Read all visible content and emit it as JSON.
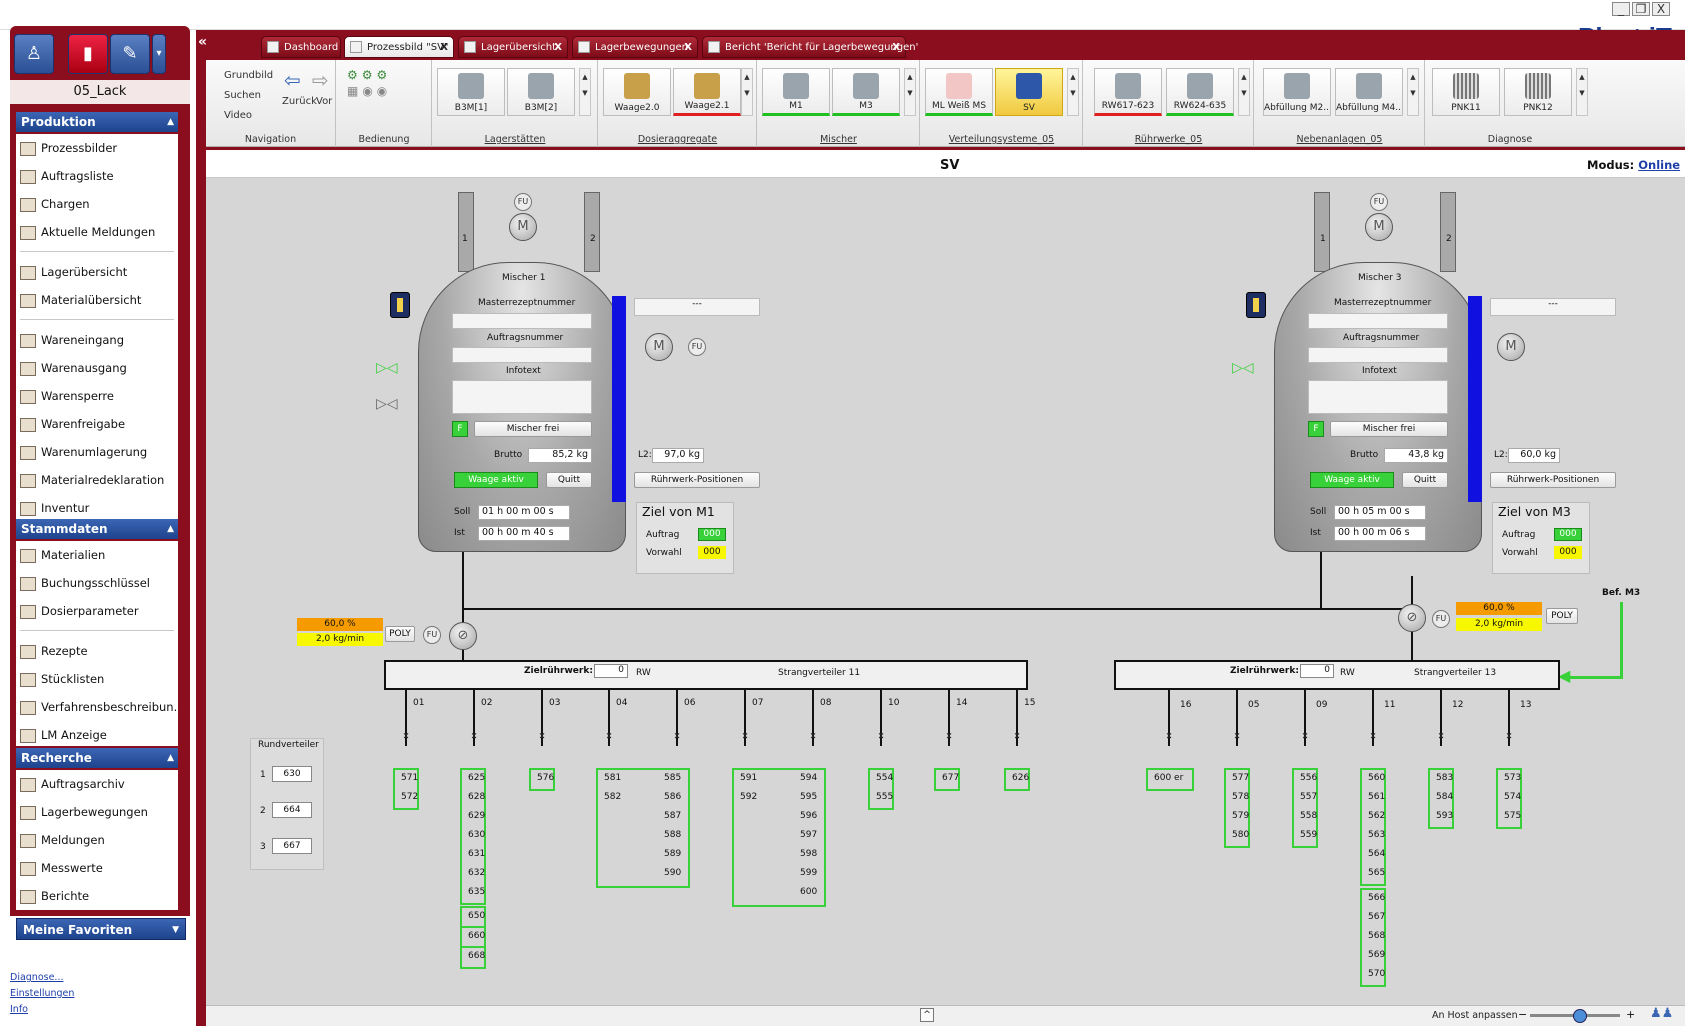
{
  "window": {
    "brand": "Plant iT",
    "controls": [
      "_",
      "❐",
      "X"
    ]
  },
  "sidebar": {
    "mode": "05_Lack",
    "sections": [
      {
        "title": "Produktion",
        "items": [
          "Prozessbilder",
          "Auftragsliste",
          "Chargen",
          "Aktuelle Meldungen",
          "Lagerübersicht",
          "Materialübersicht",
          "Wareneingang",
          "Warenausgang",
          "Warensperre",
          "Warenfreigabe",
          "Warenumlagerung",
          "Materialredeklaration",
          "Inventur"
        ]
      },
      {
        "title": "Stammdaten",
        "items": [
          "Materialien",
          "Buchungsschlüssel",
          "Dosierparameter",
          "Rezepte",
          "Stücklisten",
          "Verfahrensbeschreibun...",
          "LM Anzeige"
        ]
      },
      {
        "title": "Recherche",
        "items": [
          "Auftragsarchiv",
          "Lagerbewegungen",
          "Meldungen",
          "Messwerte",
          "Berichte"
        ]
      }
    ],
    "favorites": "Meine Favoriten",
    "footer_links": [
      "Diagnose...",
      "Einstellungen",
      "Info"
    ]
  },
  "tabs": [
    "Dashboard",
    "Prozessbild \"SV\"",
    "Lagerübersicht",
    "Lagerbewegungen",
    "Bericht 'Bericht für Lagerbewegungen'"
  ],
  "ribbon": {
    "nav": {
      "grundbild": "Grundbild",
      "suchen": "Suchen",
      "video": "Video",
      "zurueck": "Zurück",
      "vor": "Vor",
      "title": "Navigation"
    },
    "bedienung": "Bedienung",
    "groups": [
      {
        "title": "Lagerstätten",
        "buttons": [
          "B3M[1]",
          "B3M[2]"
        ]
      },
      {
        "title": "Dosieraggregate",
        "buttons": [
          "Waage2.0",
          "Waage2.1"
        ]
      },
      {
        "title": "Mischer",
        "buttons": [
          "M1",
          "M3"
        ]
      },
      {
        "title": "Verteilungsysteme_05",
        "buttons": [
          "ML Weiß MS",
          "SV"
        ]
      },
      {
        "title": "Rührwerke_05",
        "buttons": [
          "RW617-623",
          "RW624-635"
        ]
      },
      {
        "title": "Nebenanlagen_05",
        "buttons": [
          "Abfüllung M2...",
          "Abfüllung M4..."
        ]
      },
      {
        "title": "Diagnose",
        "buttons": [
          "PNK11",
          "PNK12"
        ]
      }
    ]
  },
  "page": {
    "title": "SV",
    "modus_label": "Modus:",
    "modus_value": "Online"
  },
  "status": {
    "host": "An Host anpassen",
    "zoom_minus": "−",
    "zoom_plus": "+"
  },
  "mixer1": {
    "name": "Mischer 1",
    "fu": "FU",
    "nozzle_left": "1",
    "nozzle_right": "2",
    "rezept": "Masterrezeptnummer",
    "auftrag": "Auftragsnummer",
    "info": "Infotext",
    "f": "F",
    "frei": "Mischer frei",
    "brutto_lbl": "Brutto",
    "brutto": "85,2 kg",
    "waage": "Waage aktiv",
    "quitt": "Quitt",
    "l2_lbl": "L2:",
    "l2": "97,0 kg",
    "ruehr": "Rührwerk-Positionen",
    "dash": "---",
    "soll_lbl": "Soll",
    "soll": "01 h 00 m 00 s",
    "ist_lbl": "Ist",
    "ist": "00 h 00 m 40 s",
    "ziel": "Ziel von M1",
    "auftrag_lbl": "Auftrag",
    "auftrag_val": "000",
    "vorwahl_lbl": "Vorwahl",
    "vorwahl_val": "000",
    "pct": "60,0 %",
    "rate": "2,0 kg/min",
    "poly": "POLY"
  },
  "mixer3": {
    "name": "Mischer 3",
    "fu": "FU",
    "nozzle_left": "1",
    "nozzle_right": "2",
    "rezept": "Masterrezeptnummer",
    "auftrag": "Auftragsnummer",
    "info": "Infotext",
    "f": "F",
    "frei": "Mischer frei",
    "brutto_lbl": "Brutto",
    "brutto": "43,8 kg",
    "waage": "Waage aktiv",
    "quitt": "Quitt",
    "l2_lbl": "L2:",
    "l2": "60,0 kg",
    "ruehr": "Rührwerk-Positionen",
    "dash": "---",
    "soll_lbl": "Soll",
    "soll": "00 h 05 m 00 s",
    "ist_lbl": "Ist",
    "ist": "00 h 00 m 06 s",
    "ziel": "Ziel von M3",
    "auftrag_lbl": "Auftrag",
    "auftrag_val": "000",
    "vorwahl_lbl": "Vorwahl",
    "vorwahl_val": "000",
    "pct": "60,0 %",
    "rate": "2,0 kg/min",
    "poly": "POLY",
    "bef": "Bef. M3"
  },
  "dist11": {
    "ziel_lbl": "Zielrührwerk:",
    "ziel_val": "0",
    "rw": "RW",
    "name": "Strangverteiler 11",
    "outlets": [
      "01",
      "02",
      "03",
      "04",
      "06",
      "07",
      "08",
      "10",
      "14",
      "15"
    ]
  },
  "dist13": {
    "ziel_lbl": "Zielrührwerk:",
    "ziel_val": "0",
    "rw": "RW",
    "name": "Strangverteiler 13",
    "outlets": [
      "16",
      "05",
      "09",
      "11",
      "12",
      "13"
    ]
  },
  "rund": {
    "title": "Rundverteiler",
    "rows": [
      [
        "1",
        "630"
      ],
      [
        "2",
        "664"
      ],
      [
        "3",
        "667"
      ]
    ]
  },
  "targets11": [
    [
      "571",
      "572"
    ],
    [
      "625",
      "628",
      "629",
      "630",
      "631",
      "632",
      "635",
      "650",
      "660",
      "668"
    ],
    [
      "576"
    ],
    [
      "581",
      "585",
      "582",
      "586",
      "587",
      "588",
      "589",
      "590"
    ],
    [
      "591",
      "594",
      "592",
      "595",
      "596",
      "597",
      "598",
      "599",
      "600"
    ],
    [
      "554",
      "555"
    ],
    [
      "677"
    ],
    [
      "626"
    ]
  ],
  "targets13": [
    [
      "600 er"
    ],
    [
      "577",
      "578",
      "579",
      "580"
    ],
    [
      "556",
      "557",
      "558",
      "559"
    ],
    [
      "560",
      "561",
      "562",
      "563",
      "564",
      "565",
      "566",
      "567",
      "568",
      "569",
      "570"
    ],
    [
      "583",
      "584",
      "593"
    ],
    [
      "573",
      "574",
      "575"
    ]
  ]
}
